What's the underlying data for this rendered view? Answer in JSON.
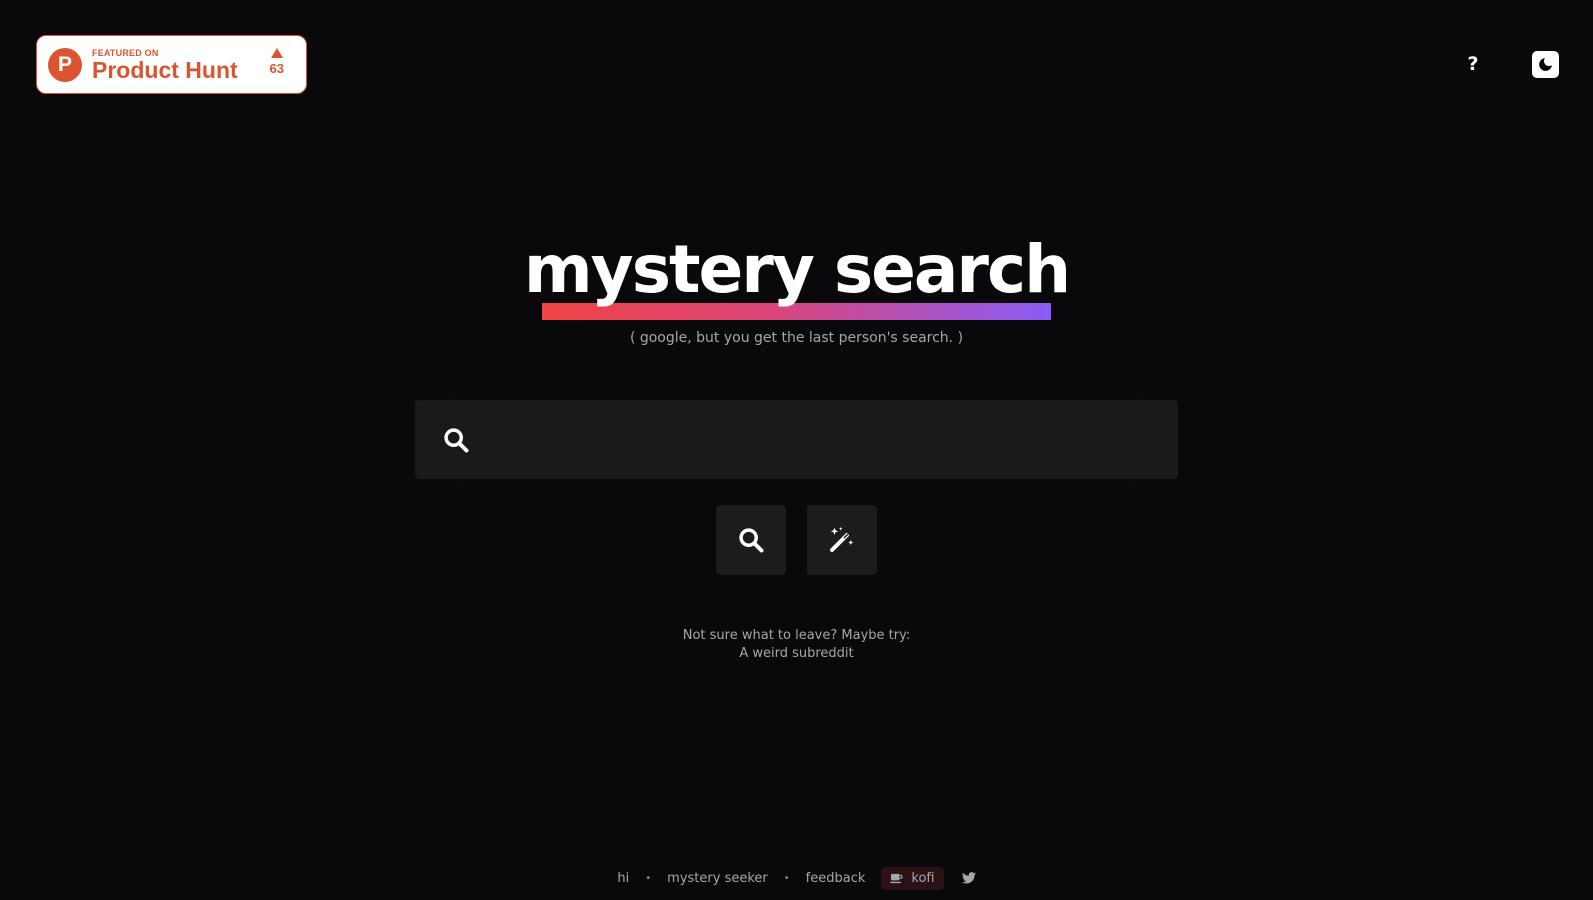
{
  "badge": {
    "featured_label": "FEATURED ON",
    "name": "Product Hunt",
    "logo_letter": "P",
    "votes": "63",
    "icon": "product-hunt-logo-icon",
    "color": "#da552f"
  },
  "header": {
    "help_label": "?",
    "theme_icon": "moon-icon"
  },
  "main": {
    "title": "mystery search",
    "subtitle": "( google, but you get the last person's search. )",
    "search": {
      "value": "",
      "placeholder": "",
      "icon": "search-icon"
    },
    "buttons": [
      {
        "name": "search",
        "icon": "search-icon"
      },
      {
        "name": "random",
        "icon": "magic-wand-icon"
      }
    ],
    "suggestion": {
      "line1": "Not sure what to leave? Maybe try:",
      "line2": "A weird subreddit"
    }
  },
  "footer": {
    "links": [
      "hi",
      "mystery seeker",
      "feedback"
    ],
    "separator": "•",
    "kofi_label": "kofi",
    "kofi_icon": "coffee-cup-icon",
    "twitter_icon": "twitter-icon"
  },
  "colors": {
    "background": "#09090b",
    "surface": "#1a1a1b",
    "gradient_start": "#ef4444",
    "gradient_end": "#8b5cf6",
    "muted_text": "#a6a6ab"
  }
}
